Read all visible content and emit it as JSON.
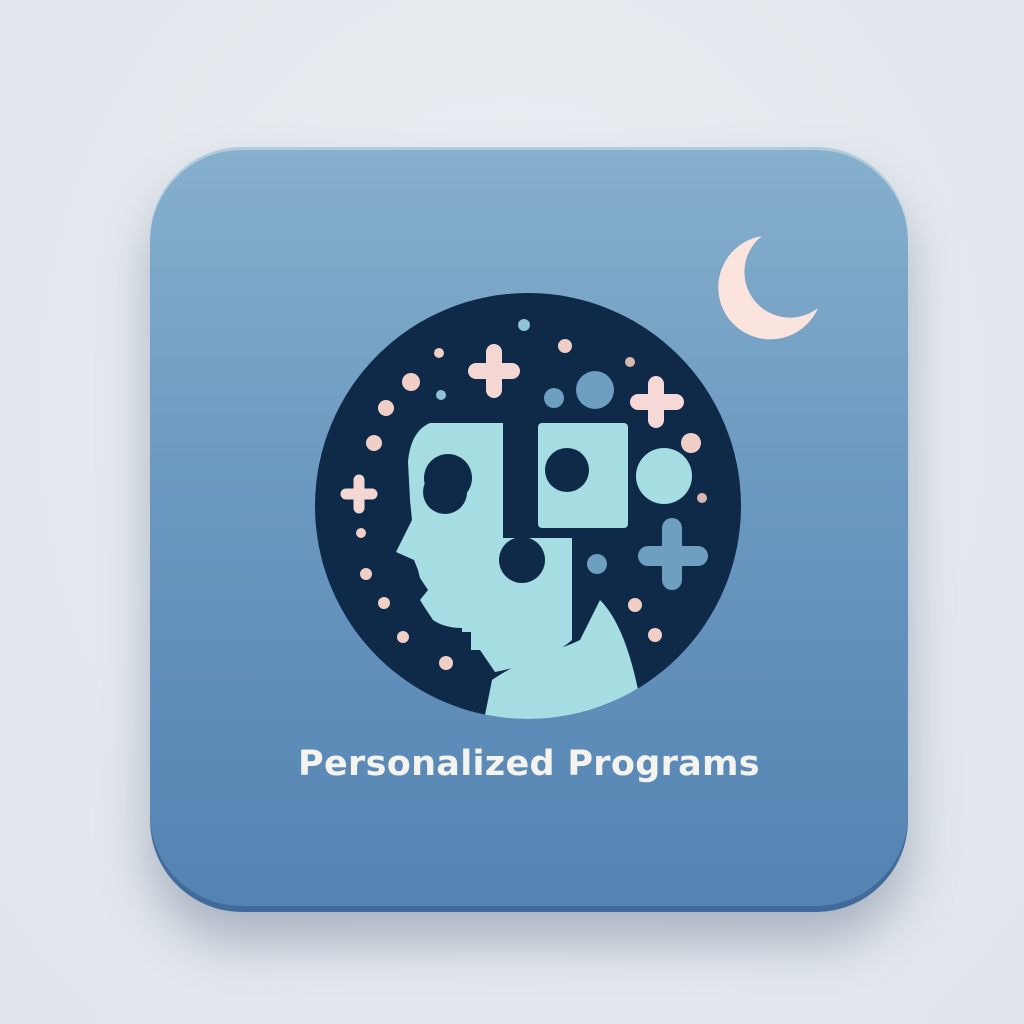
{
  "icon": {
    "label": "Personalized Programs",
    "symbols": [
      "head-profile-icon",
      "puzzle-pieces-icon",
      "moon-icon",
      "sparkle-icon",
      "dots"
    ],
    "colors": {
      "card_top": "#86b0cc",
      "card_bottom": "#5483b2",
      "circle": "#0e2a48",
      "head": "#a6dde3",
      "moon": "#fbe3de",
      "accent_pink": "#f0cfc6",
      "accent_blue": "#6e9fc0",
      "text": "#f4f3ee"
    }
  }
}
